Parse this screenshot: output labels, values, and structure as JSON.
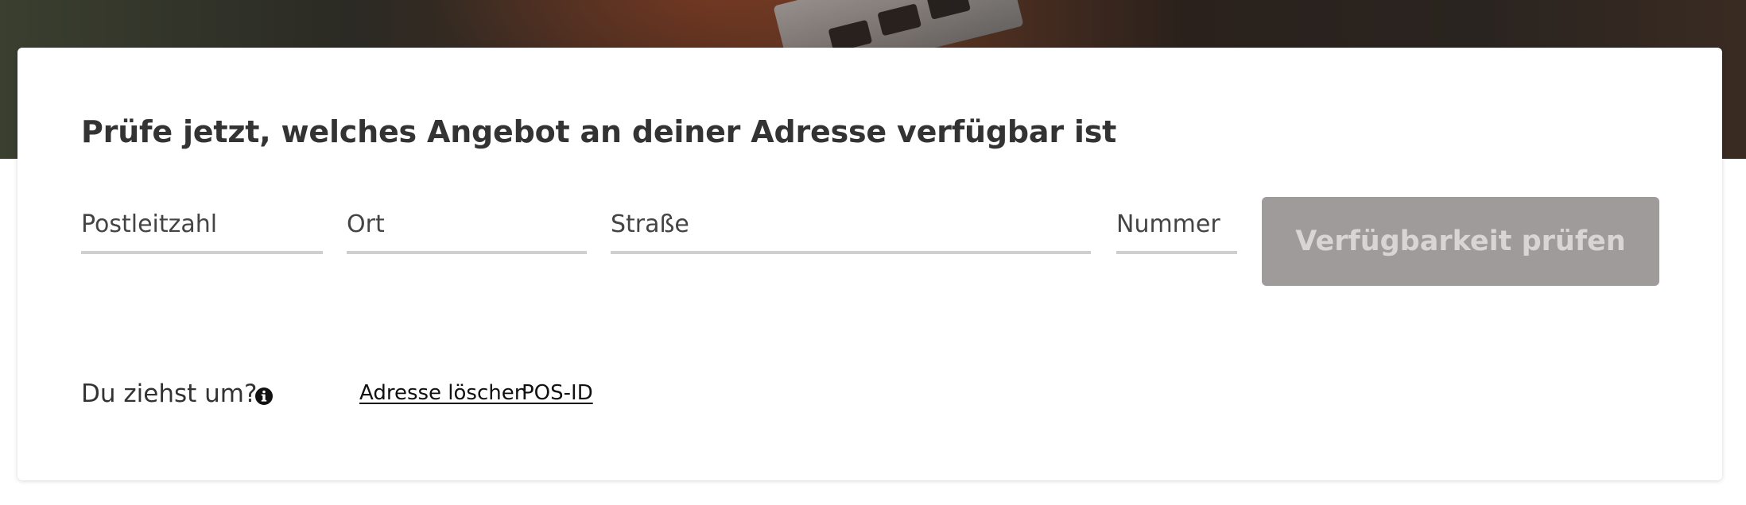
{
  "hero": {
    "background_colors": [
      "#3a3f2f",
      "#4a2a1d",
      "#5b3422",
      "#2a211c"
    ]
  },
  "availability_check": {
    "title": "Prüfe jetzt, welches Angebot an deiner Adresse verfügbar ist",
    "fields": {
      "postal_code": {
        "placeholder": "Postleitzahl",
        "value": ""
      },
      "city": {
        "placeholder": "Ort",
        "value": ""
      },
      "street": {
        "placeholder": "Straße",
        "value": ""
      },
      "number": {
        "placeholder": "Nummer",
        "value": ""
      }
    },
    "submit_label": "Verfügbarkeit prüfen",
    "submit_state": "disabled",
    "moving_label": "Du ziehst um?",
    "moving_icon": "info-icon",
    "links": {
      "clear_address": "Adresse löschen",
      "pos_id": "POS-ID"
    }
  },
  "colors": {
    "text": "#333333",
    "field_underline": "#cfcfcf",
    "button_disabled_bg": "#a09b9b",
    "button_disabled_text": "#d8d5d5"
  }
}
